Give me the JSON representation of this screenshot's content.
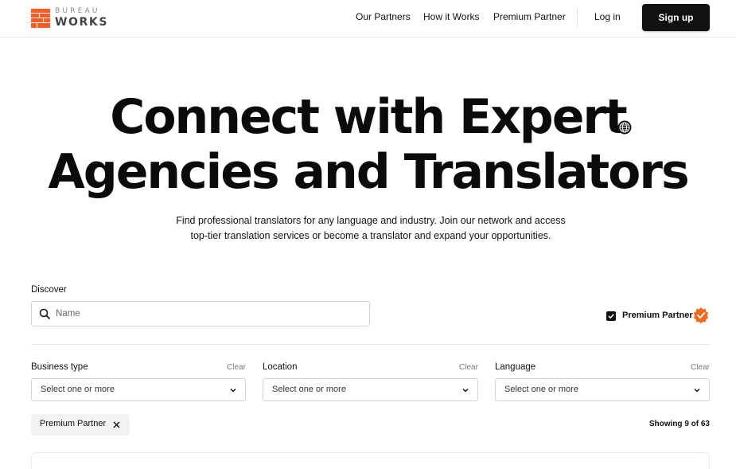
{
  "brand": {
    "top": "BUREAU",
    "bottom": "WORKS",
    "accent_color": "#ff5a1f"
  },
  "nav": {
    "links": [
      "Our Partners",
      "How it Works",
      "Premium Partner"
    ],
    "login": "Log in",
    "signup": "Sign up"
  },
  "hero": {
    "title_line1": "Connect with Expert",
    "title_line2": "Agencies and Translators",
    "subtitle_line1": "Find professional translators for any language and industry. Join our network and access",
    "subtitle_line2": "top-tier translation services or become a translator and expand your opportunities.",
    "icon": "globe-icon"
  },
  "discover": {
    "label": "Discover",
    "search_placeholder": "Name",
    "search_value": "",
    "premium_checkbox_label": "Premium Partner",
    "premium_checked": true,
    "premium_badge_color": "#f26a1b"
  },
  "filters": [
    {
      "label": "Business type",
      "clear": "Clear",
      "placeholder": "Select one or more"
    },
    {
      "label": "Location",
      "clear": "Clear",
      "placeholder": "Select one or more"
    },
    {
      "label": "Language",
      "clear": "Clear",
      "placeholder": "Select one or more"
    }
  ],
  "active_chips": [
    {
      "label": "Premium Partner"
    }
  ],
  "results": {
    "showing": "Showing 9 of 63"
  }
}
